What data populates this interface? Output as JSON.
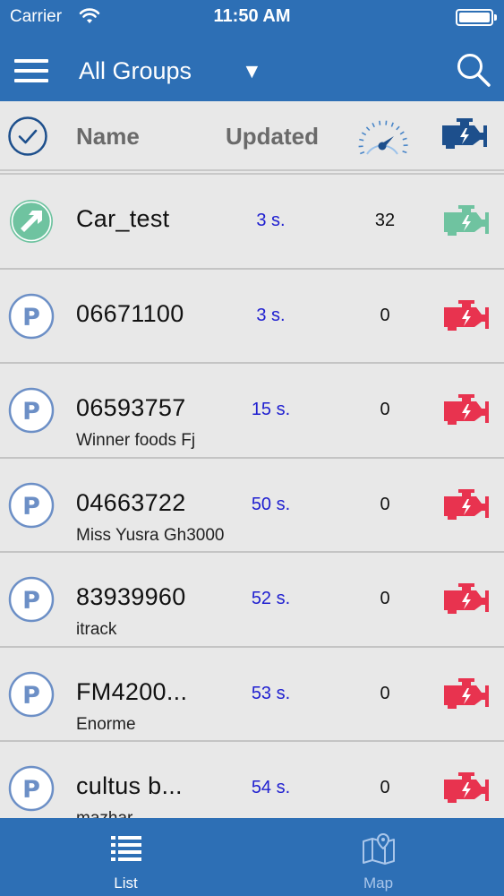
{
  "status_bar": {
    "carrier": "Carrier",
    "time": "11:50 AM"
  },
  "header": {
    "title": "All Groups",
    "dropdown_caret": "▼"
  },
  "columns": {
    "name": "Name",
    "updated": "Updated"
  },
  "vehicles": [
    {
      "name": "Car_test",
      "subtitle": "",
      "updated": "3 s.",
      "speed": "32",
      "status": "moving",
      "engine": "on"
    },
    {
      "name": "06671100",
      "subtitle": "",
      "updated": "3 s.",
      "speed": "0",
      "status": "parked",
      "engine": "off"
    },
    {
      "name": "06593757",
      "subtitle": "Winner foods Fj",
      "updated": "15 s.",
      "speed": "0",
      "status": "parked",
      "engine": "off"
    },
    {
      "name": "04663722",
      "subtitle": "Miss Yusra Gh3000",
      "updated": "50 s.",
      "speed": "0",
      "status": "parked",
      "engine": "off"
    },
    {
      "name": "83939960",
      "subtitle": "itrack",
      "updated": "52 s.",
      "speed": "0",
      "status": "parked",
      "engine": "off"
    },
    {
      "name": "FM4200...",
      "subtitle": "Enorme",
      "updated": "53 s.",
      "speed": "0",
      "status": "parked",
      "engine": "off"
    },
    {
      "name": "cultus b...",
      "subtitle": "mazhar",
      "updated": "54 s.",
      "speed": "0",
      "status": "parked",
      "engine": "off"
    }
  ],
  "tabs": [
    {
      "label": "List",
      "icon": "list-icon",
      "active": true
    },
    {
      "label": "Map",
      "icon": "map-icon",
      "active": false
    }
  ],
  "colors": {
    "brand_blue": "#2d6fb5",
    "engine_on": "#6fc3a0",
    "engine_off": "#e8334f",
    "engine_header": "#1d4f8c",
    "updated_text": "#2020d0",
    "parked_icon": "#6c8fc6"
  }
}
